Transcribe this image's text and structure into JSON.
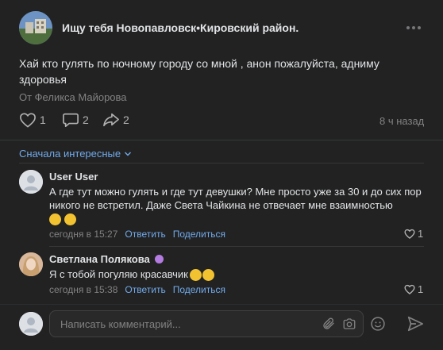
{
  "post": {
    "group_name": "Ищу тебя Новопавловск•Кировский район.",
    "text": "Хай кто гулять по ночному городу со мной , анон пожалуйста, адниму здоровья",
    "author": "От Феликса Майорова",
    "likes": "1",
    "comments": "2",
    "shares": "2",
    "time": "8 ч назад"
  },
  "comments_section": {
    "sort_label": "Сначала интересные",
    "items": [
      {
        "name": "User User",
        "text": "А где тут можно гулять и где тут девушки? Мне просто уже за 30 и до сих пор никого не встретил. Даже Света Чайкина не отвечает мне взаимностью",
        "time": "сегодня в 15:27",
        "reply": "Ответить",
        "share": "Поделиться",
        "likes": "1"
      },
      {
        "name": "Светлана Полякова",
        "text": "Я с тобой погуляю красавчик",
        "time": "сегодня в 15:38",
        "reply": "Ответить",
        "share": "Поделиться",
        "likes": "1"
      }
    ]
  },
  "composer": {
    "placeholder": "Написать комментарий..."
  },
  "colors": {
    "background": "#222222",
    "link": "#71aaeb",
    "muted": "#828282",
    "text": "#e1e3e6"
  },
  "icons": [
    "more-icon",
    "heart-icon",
    "comment-icon",
    "share-icon",
    "chevron-down-icon",
    "attach-icon",
    "camera-icon",
    "emoji-icon",
    "send-icon"
  ]
}
